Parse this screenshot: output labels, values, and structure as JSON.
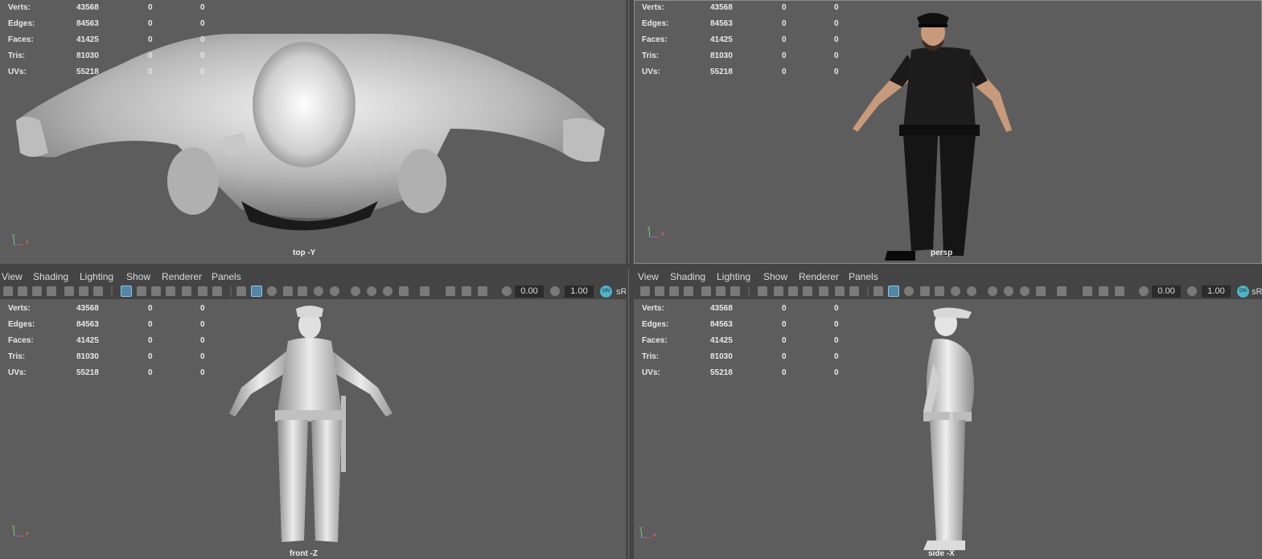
{
  "stats": {
    "labels": [
      "Verts:",
      "Edges:",
      "Faces:",
      "Tris:",
      "UVs:"
    ],
    "values": [
      [
        "43568",
        "0",
        "0"
      ],
      [
        "84563",
        "0",
        "0"
      ],
      [
        "41425",
        "0",
        "0"
      ],
      [
        "81030",
        "0",
        "0"
      ],
      [
        "55218",
        "0",
        "0"
      ]
    ]
  },
  "viewports": {
    "top": {
      "label": "top -Y"
    },
    "persp": {
      "label": "persp"
    },
    "front": {
      "label": "front -Z"
    },
    "side": {
      "label": "side -X"
    }
  },
  "panel_menu": {
    "items": [
      "View",
      "Shading",
      "Lighting",
      "Show",
      "Renderer",
      "Panels"
    ]
  },
  "toolbar": {
    "exposure": "0.00",
    "gamma": "1.00",
    "color_space_badge": "ON",
    "color_space_text": "sR"
  },
  "axis": {
    "y": "y",
    "x": "x"
  },
  "icons": [
    "camera-icon",
    "bookmark-icon",
    "grid-icon",
    "film-gate-icon",
    "wireframe-icon",
    "smooth-shade-icon",
    "textured-icon",
    "lights-icon",
    "shadows-icon",
    "isolate-icon",
    "xray-icon",
    "exposure-icon",
    "gamma-icon"
  ],
  "colors": {
    "viewport_bg": "#5d5d5d",
    "panel_bg": "#444444",
    "active_icon": "#5285a6",
    "uniform": "#1a1a1a",
    "skin": "#c89a7c"
  }
}
